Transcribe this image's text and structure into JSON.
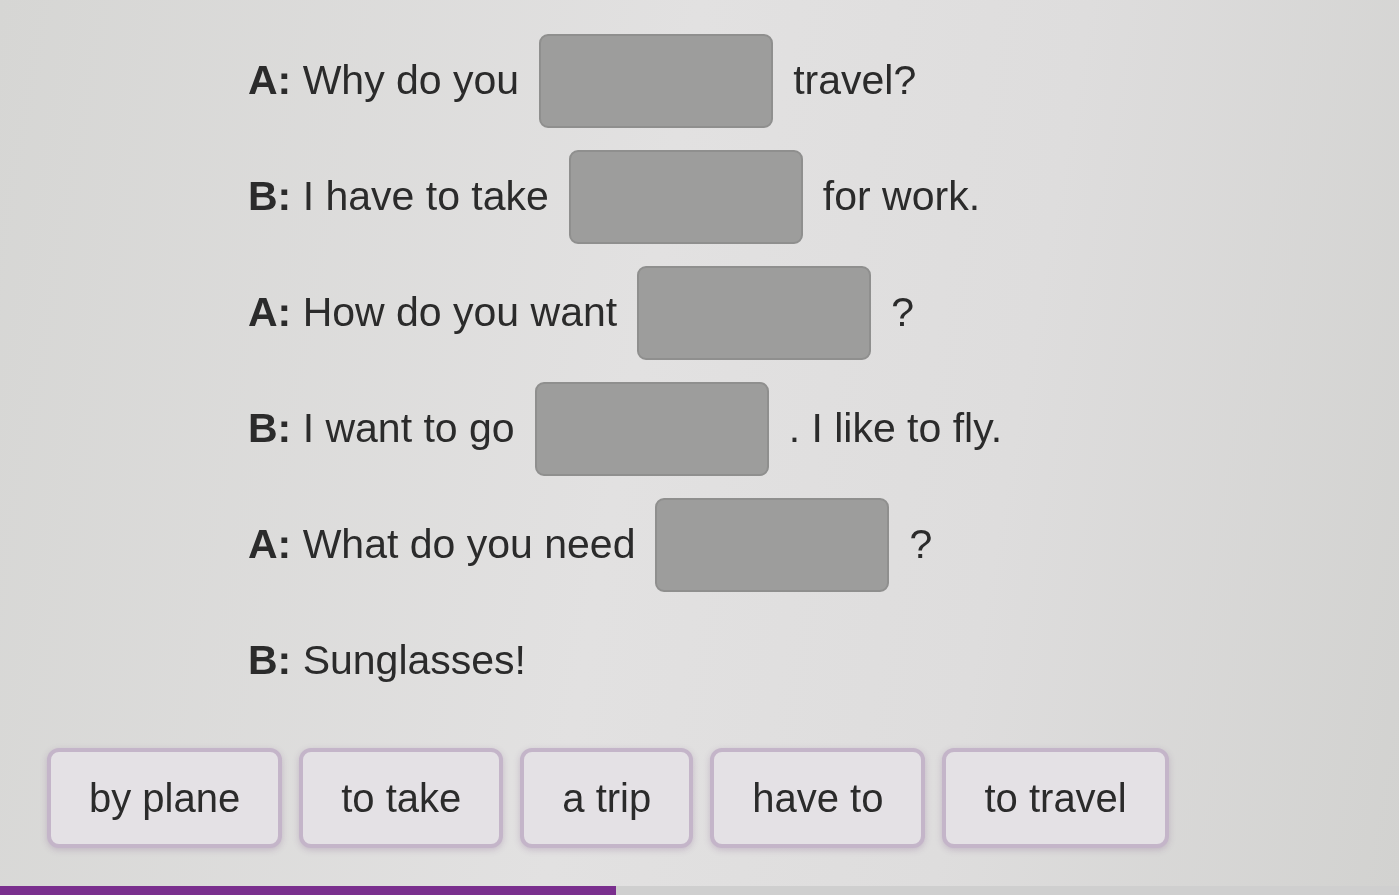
{
  "dialogue": [
    {
      "before": "**A:** Why do you",
      "blank": true,
      "after": "travel?"
    },
    {
      "before": "**B:** I have to take",
      "blank": true,
      "after": "for work."
    },
    {
      "before": "**A:** How do you want",
      "blank": true,
      "after": "?"
    },
    {
      "before": "**B:** I want to go",
      "blank": true,
      "after": ". I like to fly."
    },
    {
      "before": "**A:** What do you need",
      "blank": true,
      "after": "?"
    },
    {
      "before": "**B:** Sunglasses!",
      "blank": false
    }
  ],
  "word_bank": [
    {
      "label": "by plane"
    },
    {
      "label": "to take"
    },
    {
      "label": "a trip"
    },
    {
      "label": "have to"
    },
    {
      "label": "to travel"
    }
  ],
  "progress": {
    "level": 0.44
  }
}
